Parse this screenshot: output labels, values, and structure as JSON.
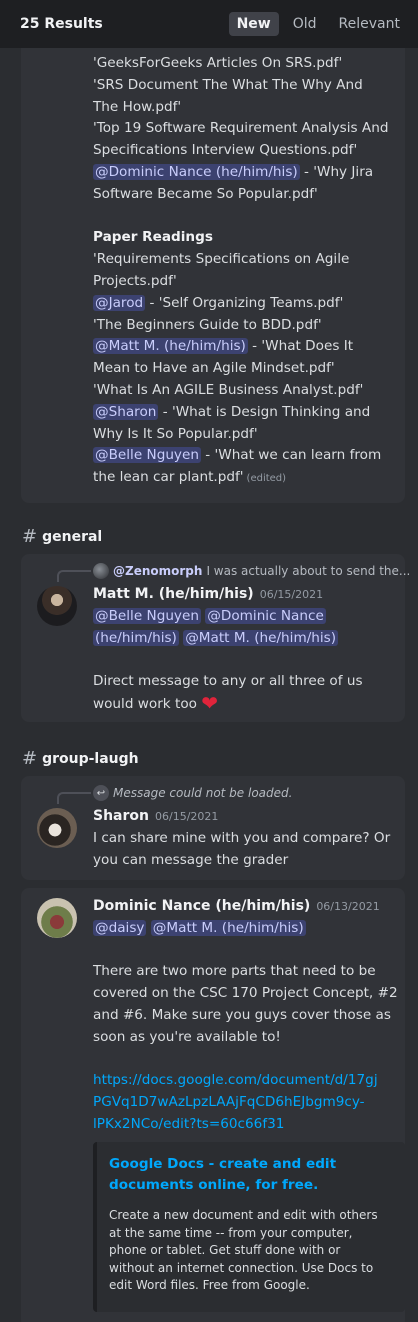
{
  "header": {
    "results_label": "25 Results",
    "sort_options": [
      "New",
      "Old",
      "Relevant"
    ],
    "active_sort": "New"
  },
  "card1": {
    "lines": [
      "'GeeksForGeeks Articles On SRS.pdf'",
      "'SRS Document The What The Why And",
      "The How.pdf'",
      "'Top 19 Software Requirement Analysis And",
      "Specifications Interview Questions.pdf'"
    ],
    "mention_dominic": "@Dominic Nance (he/him/his)",
    "dominic_after": " - 'Why Jira",
    "line_jira2": "Software Became So Popular.pdf'",
    "section_title": "Paper Readings",
    "line_req1": "'Requirements Specifications on Agile",
    "line_req2": "Projects.pdf'",
    "mention_jarod": "@Jarod",
    "jarod_after": " - 'Self Organizing Teams.pdf'",
    "line_bdd": " 'The Beginners Guide to BDD.pdf'",
    "mention_matt": "@Matt M. (he/him/his)",
    "matt_after": " - 'What Does It",
    "line_agile2": "Mean to Have an Agile Mindset.pdf'",
    "line_ba": "'What Is An AGILE Business Analyst.pdf'",
    "mention_sharon": "@Sharon",
    "sharon_after": "  - 'What is Design Thinking and",
    "line_design2": "Why Is It So Popular.pdf'",
    "mention_belle": "@Belle Nguyen",
    "belle_after": " - 'What we can learn from",
    "line_lean2": "the lean car plant.pdf'",
    "edited": "(edited)"
  },
  "channel_general": "general",
  "card2": {
    "reply_author": "@Zenomorph",
    "reply_text": "I was actually about to send the...",
    "author": "Matt M. (he/him/his)",
    "timestamp": "06/15/2021",
    "mention_belle": "@Belle Nguyen",
    "mention_dominic_1": "@Dominic Nance",
    "mention_dominic_2": "(he/him/his)",
    "mention_matt": "@Matt M. (he/him/his)",
    "line1": "Direct message to any or all three of us",
    "line2": "would work too",
    "emoji": "❤"
  },
  "channel_group_laugh": "group-laugh",
  "card3": {
    "reply_text": "Message could not be loaded.",
    "author": "Sharon",
    "timestamp": "06/15/2021",
    "line1": "I can share mine with you and compare? Or",
    "line2": "you can message the grader"
  },
  "card4": {
    "author": "Dominic Nance (he/him/his)",
    "timestamp": "06/13/2021",
    "mention_daisy": "@daisy",
    "mention_matt": "@Matt M. (he/him/his)",
    "body_lines": [
      "There are two more parts that need to be",
      "covered on the CSC 170 Project Concept, #2",
      "and #6. Make sure you guys cover those as",
      "soon as you're available to!"
    ],
    "link_lines": [
      "https://docs.google.com/document/d/17gj",
      "PGVq1D7wAzLpzLAAjFqCD6hEJbgm9cy-",
      "lPKx2NCo/edit?ts=60c66f31"
    ],
    "embed_title_1": "Google Docs - create and edit",
    "embed_title_2": "documents online, for free.",
    "embed_desc": [
      "Create a new document and edit with others",
      "at the same time -- from your computer,",
      "phone or tablet. Get stuff done with or",
      "without an internet connection. Use Docs to",
      "edit Word files. Free from Google."
    ]
  }
}
